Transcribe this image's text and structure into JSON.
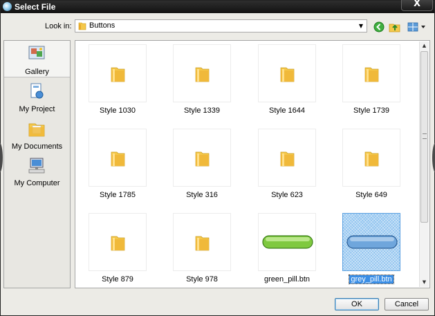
{
  "window": {
    "title": "Select File",
    "close_label": "X"
  },
  "lookin": {
    "label": "Look in:",
    "value": "Buttons"
  },
  "places": [
    {
      "label": "Gallery",
      "icon": "gallery-icon",
      "selected": true
    },
    {
      "label": "My Project",
      "icon": "project-icon",
      "selected": false
    },
    {
      "label": "My Documents",
      "icon": "documents-folder-icon",
      "selected": false
    },
    {
      "label": "My Computer",
      "icon": "computer-icon",
      "selected": false
    }
  ],
  "files": [
    {
      "label": "Style 1030",
      "type": "folder"
    },
    {
      "label": "Style 1339",
      "type": "folder"
    },
    {
      "label": "Style 1644",
      "type": "folder"
    },
    {
      "label": "Style 1739",
      "type": "folder"
    },
    {
      "label": "Style 1785",
      "type": "folder"
    },
    {
      "label": "Style 316",
      "type": "folder"
    },
    {
      "label": "Style 623",
      "type": "folder"
    },
    {
      "label": "Style 649",
      "type": "folder"
    },
    {
      "label": "Style 879",
      "type": "folder"
    },
    {
      "label": "Style 978",
      "type": "folder"
    },
    {
      "label": "green_pill.btn",
      "type": "button-file",
      "color": "#7fc93f"
    },
    {
      "label": "grey_pill.btn",
      "type": "button-file",
      "color": "#6fa6dc",
      "selected": true
    }
  ],
  "buttons": {
    "ok": "OK",
    "cancel": "Cancel"
  },
  "colors": {
    "titlebar": "#1b1b1b",
    "selection": "#3a8ee6",
    "folder": "#f5c84a"
  }
}
